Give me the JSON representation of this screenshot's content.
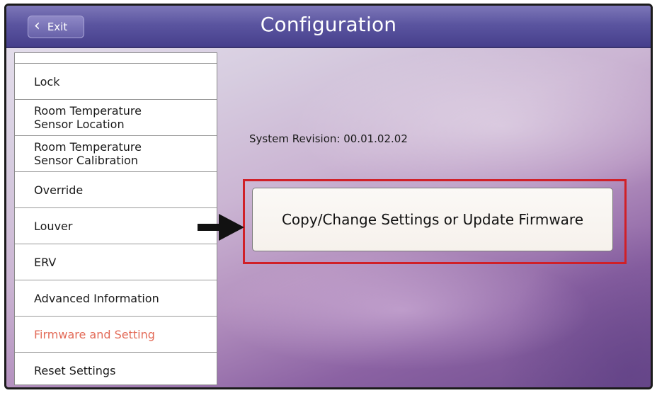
{
  "header": {
    "exit_label": "Exit",
    "title": "Configuration"
  },
  "menu": {
    "items": [
      {
        "label_lines": [
          "Lock"
        ],
        "active": false
      },
      {
        "label_lines": [
          "Room Temperature",
          "Sensor Location"
        ],
        "active": false
      },
      {
        "label_lines": [
          "Room Temperature",
          "Sensor Calibration"
        ],
        "active": false
      },
      {
        "label_lines": [
          "Override"
        ],
        "active": false
      },
      {
        "label_lines": [
          "Louver"
        ],
        "active": false
      },
      {
        "label_lines": [
          "ERV"
        ],
        "active": false
      },
      {
        "label_lines": [
          "Advanced Information"
        ],
        "active": false
      },
      {
        "label_lines": [
          "Firmware and Setting"
        ],
        "active": true
      },
      {
        "label_lines": [
          "Reset Settings"
        ],
        "active": false
      }
    ]
  },
  "content": {
    "system_revision": "System Revision: 00.01.02.02",
    "copy_button_label": "Copy/Change Settings or Update Firmware"
  },
  "colors": {
    "active_menu_text": "#e36b58",
    "callout_border": "#d02028",
    "title_bar": "#5b55a0"
  },
  "icons": {
    "exit": "chevron-left-icon",
    "callout": "arrow-right-icon"
  }
}
